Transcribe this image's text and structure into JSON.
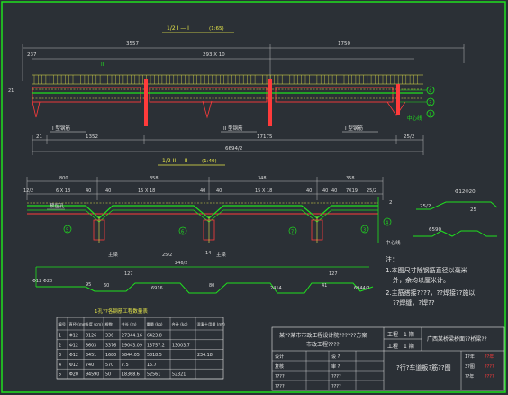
{
  "drawing": {
    "title_top": "1/2 I — I",
    "title_top_scale": "(1:65)",
    "title_mid": "1/2 II — II",
    "title_mid_scale": "(1:40)",
    "dims_top": {
      "d1": "3557",
      "d2": "1750",
      "d3": "293 X 10",
      "left_small": "237",
      "left_big": "21",
      "bottom_1": "21",
      "bottom_2": "1352",
      "bottom_3": "17175",
      "bottom_4": "25/2",
      "bottom_total": "6694/2",
      "side": "II"
    },
    "labels_top": {
      "steel_1": "I 型钢筋",
      "steel_2": "II 型钢筋",
      "steel_3": "I 型钢筋",
      "center_line": "中心线",
      "callout_4": "4",
      "callout_3": "3",
      "callout_1": "1"
    },
    "dims_mid": {
      "d1": "800",
      "d2": "358",
      "d3": "348",
      "d4": "358",
      "s1": "6 X 13",
      "s2": "15 X 18",
      "s3": "15 X 18",
      "s4": "7X19",
      "a1": "12/2",
      "a2": "40",
      "a3": "40",
      "a4": "40",
      "a5": "40",
      "a6": "40",
      "a7": "40",
      "a8": "40",
      "a9": "25/2"
    },
    "labels_mid": {
      "main_1": "主梁",
      "main_2": "主梁",
      "hole": "预留孔",
      "center": "中心线",
      "c5": "5",
      "c6": "6",
      "c7": "7",
      "c3": "3",
      "c4": "4"
    },
    "rebar_text": {
      "r1": "25/2",
      "r2": "246/2",
      "r3": "14",
      "r4": "127",
      "r5": "127",
      "r6": "95",
      "r7": "60",
      "r8": "80",
      "r9": "41",
      "r10": "6916",
      "r11": "2414",
      "r12": "6944/2",
      "r13": "Φ12 Φ20"
    },
    "detail_right": {
      "label_a": "Φ12Φ20",
      "label_b": "25",
      "label_c": "6590",
      "label_d": "25/2",
      "label_e": "2"
    },
    "notes": {
      "header": "注：",
      "n1": "1.本图尺寸除钢筋直径以毫米",
      "n1b": "外，余均以厘米计。",
      "n2": "2.主筋搭接????，??焊接??施以",
      "n2b": "??焊缝，?焊??"
    },
    "table": {
      "title": "1孔??各钢筋工程数量表",
      "headers": [
        "编号",
        "直径 (mm)",
        "长度 (cm)",
        "根数",
        "共长 (m)",
        "重量 (kg)",
        "合计 (kg)",
        "混凝土用量 (m³)"
      ],
      "rows": [
        [
          "1",
          "Φ12",
          "8126",
          "336",
          "27344.16",
          "6423.8",
          "",
          ""
        ],
        [
          "2",
          "Φ12",
          "8603",
          "3376",
          "29043.09",
          "13757.2",
          "13003.7",
          ""
        ],
        [
          "3",
          "Φ12",
          "3451",
          "1680",
          "5844.05",
          "5818.5",
          "",
          "234.18"
        ],
        [
          "4",
          "Φ12",
          "740",
          "570",
          "7.5",
          "15.7",
          "",
          ""
        ],
        [
          "5",
          "Φ20",
          "94590",
          "50",
          "18368.6",
          "52561",
          "52321",
          ""
        ]
      ]
    },
    "titleblock": {
      "org": "某??某市市政工程设计院??????方案",
      "org2": "市政工程????",
      "project_label": "工程",
      "project_val": "1 期",
      "part_label": "工程",
      "part_val": "1 期",
      "drawing_name": "广西某桥梁桥面??桥梁??",
      "sheet_name": "?行?车道板?筋??图",
      "row_labels": [
        "设计",
        "复核",
        "????",
        "????"
      ],
      "right_labels": [
        "设 ?",
        "审 ?",
        "????",
        "????"
      ],
      "meta": [
        "1?年",
        "3?图",
        "??年"
      ],
      "red_1": "??年",
      "red_2": "????",
      "red_3": "????"
    }
  }
}
